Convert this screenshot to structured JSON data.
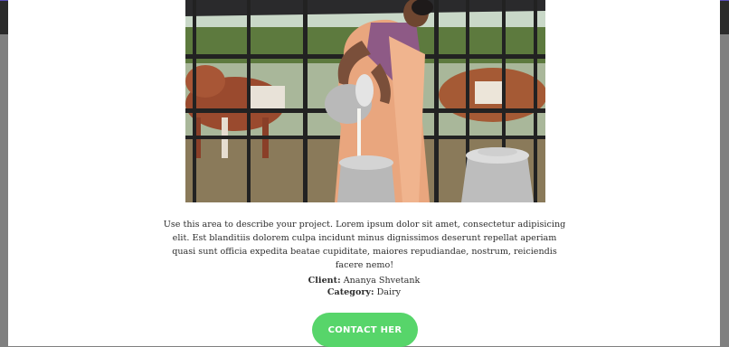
{
  "modal": {
    "image_alt": "Woman pouring milk into milk cans at a dairy farm",
    "description": "Use this area to describe your project. Lorem ipsum dolor sit amet, consectetur adipisicing elit. Est blanditiis dolorem culpa incidunt minus dignissimos deserunt repellat aperiam quasi sunt officia expedita beatae cupiditate, maiores repudiandae, nostrum, reiciendis facere nemo!",
    "client_label": "Client:",
    "client_value": "Ananya Shvetank",
    "category_label": "Category:",
    "category_value": "Dairy",
    "contact_button": "CONTACT HER"
  },
  "colors": {
    "button": "#57d56a",
    "overlay": "#808080",
    "header": "#2b2b2b"
  }
}
